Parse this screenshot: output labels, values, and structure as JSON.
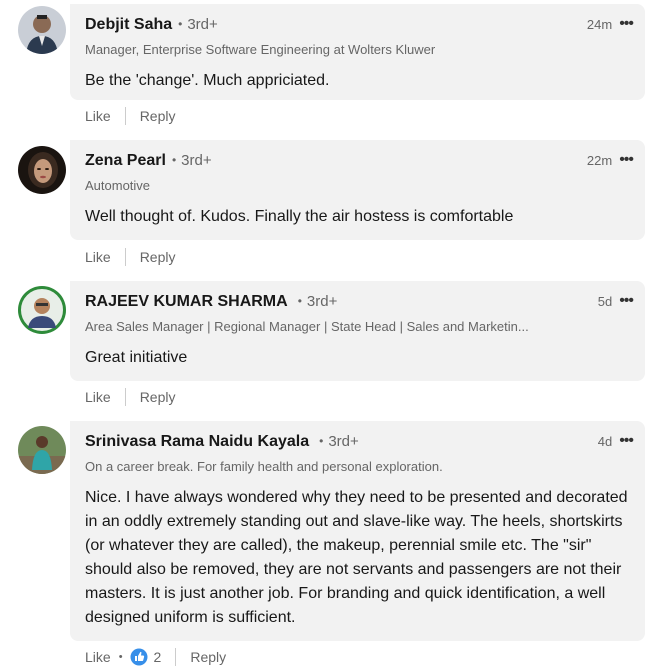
{
  "actions": {
    "like": "Like",
    "reply": "Reply"
  },
  "comments": [
    {
      "name": "Debjit Saha",
      "degree": "3rd+",
      "headline": "Manager, Enterprise Software Engineering at Wolters Kluwer",
      "time": "24m",
      "more": "•••",
      "text": "Be the 'change'. Much appriciated."
    },
    {
      "name": "Zena Pearl",
      "degree": "3rd+",
      "headline": "Automotive",
      "time": "22m",
      "more": "•••",
      "text": "Well thought of. Kudos. Finally the air hostess is comfortable"
    },
    {
      "name": "RAJEEV KUMAR SHARMA",
      "degree": "3rd+",
      "headline": "Area Sales Manager | Regional Manager | State Head | Sales and Marketin...",
      "time": "5d",
      "more": "•••",
      "text": "Great initiative"
    },
    {
      "name": "Srinivasa Rama Naidu Kayala",
      "degree": "3rd+",
      "headline": "On a career break. For family health and personal exploration.",
      "time": "4d",
      "more": "•••",
      "text": "Nice. I have always wondered why they need to be presented and decorated in an oddly extremely standing out and slave-like way. The heels, shortskirts (or whatever they are called), the makeup, perennial smile etc. The \"sir\" should also be removed, they are not servants and passengers are not their masters. It is just another job. For branding and quick identification, a well designed uniform is sufficient.",
      "reactions": "2"
    }
  ],
  "colors": {
    "bubble": "#f2f2f2",
    "like_blue": "#378fe9"
  }
}
